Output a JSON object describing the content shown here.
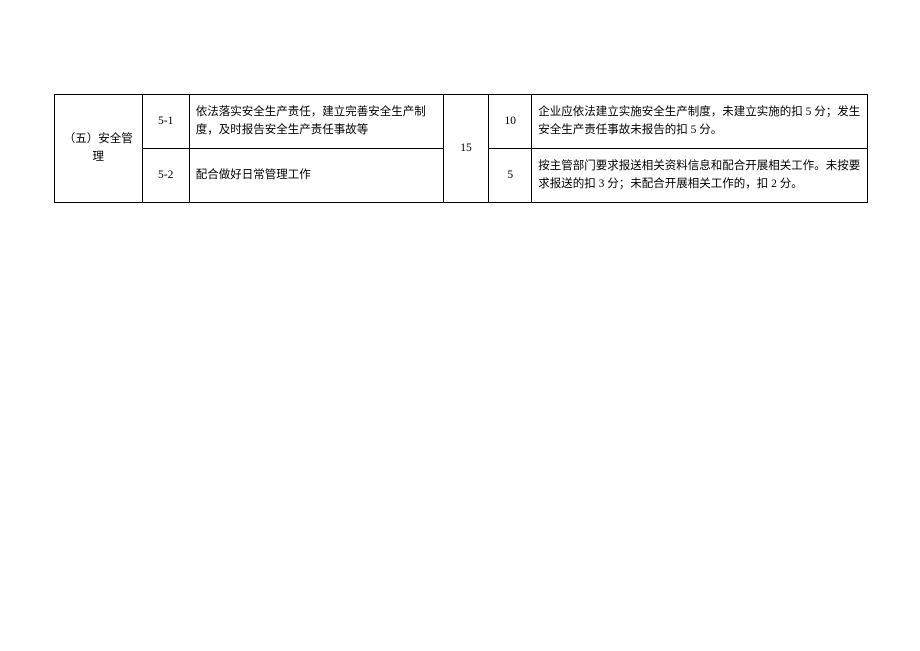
{
  "table": {
    "category": "（五）安全管理",
    "categoryScore": "15",
    "rows": [
      {
        "id": "5-1",
        "content": "依法落实安全生产责任，建立完善安全生产制度，及时报告安全生产责任事故等",
        "score": "10",
        "criteria": "企业应依法建立实施安全生产制度，未建立实施的扣 5 分；发生安全生产责任事故未报告的扣 5 分。"
      },
      {
        "id": "5-2",
        "content": "配合做好日常管理工作",
        "score": "5",
        "criteria": "按主管部门要求报送相关资料信息和配合开展相关工作。未按要求报送的扣 3 分；未配合开展相关工作的，扣 2 分。"
      }
    ]
  }
}
